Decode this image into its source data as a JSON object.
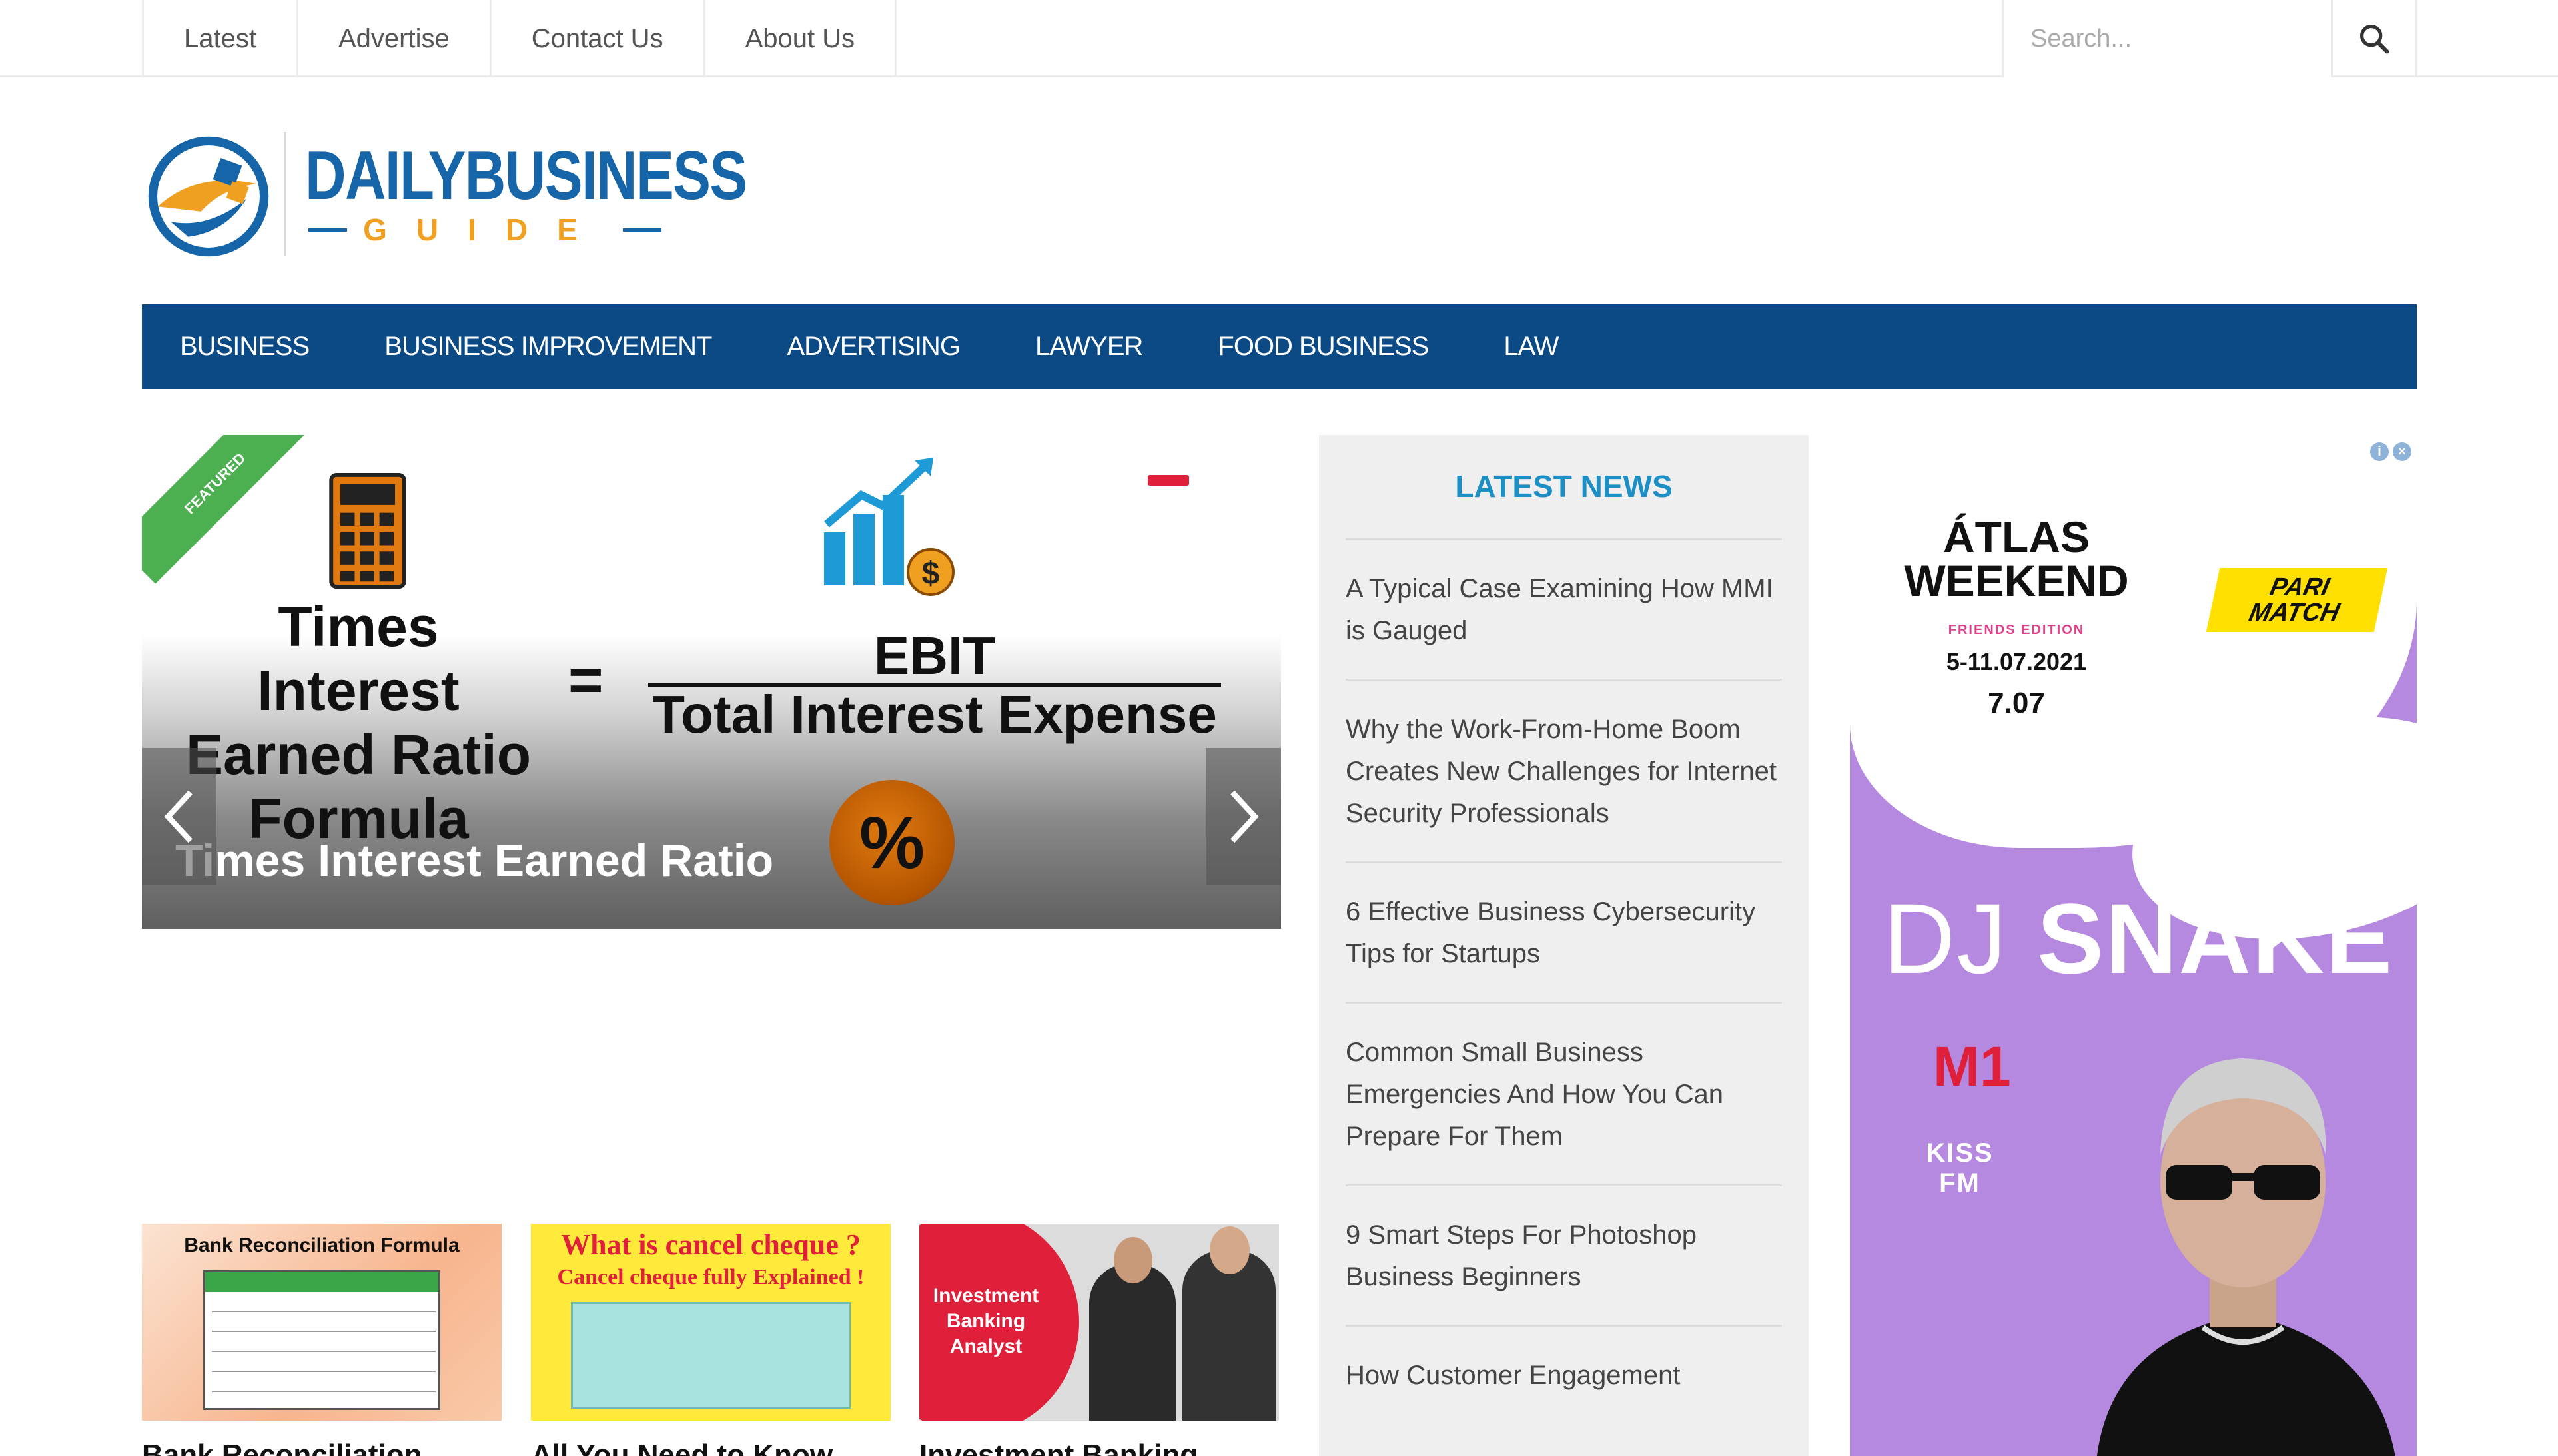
{
  "topbar": {
    "links": [
      "Latest",
      "Advertise",
      "Contact Us",
      "About Us"
    ],
    "search_placeholder": "Search..."
  },
  "logo": {
    "word": "DAILYBUSINESS",
    "sub": "GUIDE"
  },
  "nav": {
    "items": [
      "BUSINESS",
      "BUSINESS IMPROVEMENT",
      "ADVERTISING",
      "LAWYER",
      "FOOD BUSINESS",
      "LAW"
    ]
  },
  "slider": {
    "ribbon": "FEATURED",
    "formula_left": [
      "Times Interest",
      "Earned Ratio",
      "Formula"
    ],
    "equals": "=",
    "numerator": "EBIT",
    "denominator": "Total Interest Expense",
    "percent": "%",
    "caption": "Times Interest Earned Ratio"
  },
  "thumbnails": [
    {
      "heading": "Bank Reconciliation Formula",
      "title": "Bank Reconciliation"
    },
    {
      "line1": "What is cancel cheque ?",
      "line2": "Cancel cheque fully Explained !",
      "title": "All You Need to Know"
    },
    {
      "label_lines": [
        "Investment",
        "Banking",
        "Analyst"
      ],
      "title": "Investment Banking"
    }
  ],
  "latest_news": {
    "title": "LATEST NEWS",
    "items": [
      "A Typical Case Examining How MMI is Gauged",
      "Why the Work-From-Home Boom Creates New Challenges for Internet Security Professionals",
      "6 Effective Business Cybersecurity Tips for Startups",
      "Common Small Business Emergencies And How You Can Prepare For Them",
      "9 Smart Steps For Photoshop Business Beginners",
      "How Customer Engagement"
    ]
  },
  "ad": {
    "atlas_line1": "ÁTLAS",
    "atlas_line2": "WEEKEND",
    "edition": "FRIENDS EDITION",
    "dates": "5-11.07.2021",
    "date2": "7.07",
    "sponsor_line1": "PARI",
    "sponsor_line2": "MATCH",
    "artist_thin": "DJ",
    "artist_bold": "SNAKE",
    "m1": "M1",
    "radio": "KISS FM"
  },
  "colors": {
    "nav_bg": "#0b4a85",
    "logo_blue": "#1565a8",
    "logo_orange": "#f0a020",
    "news_title": "#1d8fc4",
    "ad_bg": "#b589e0"
  }
}
